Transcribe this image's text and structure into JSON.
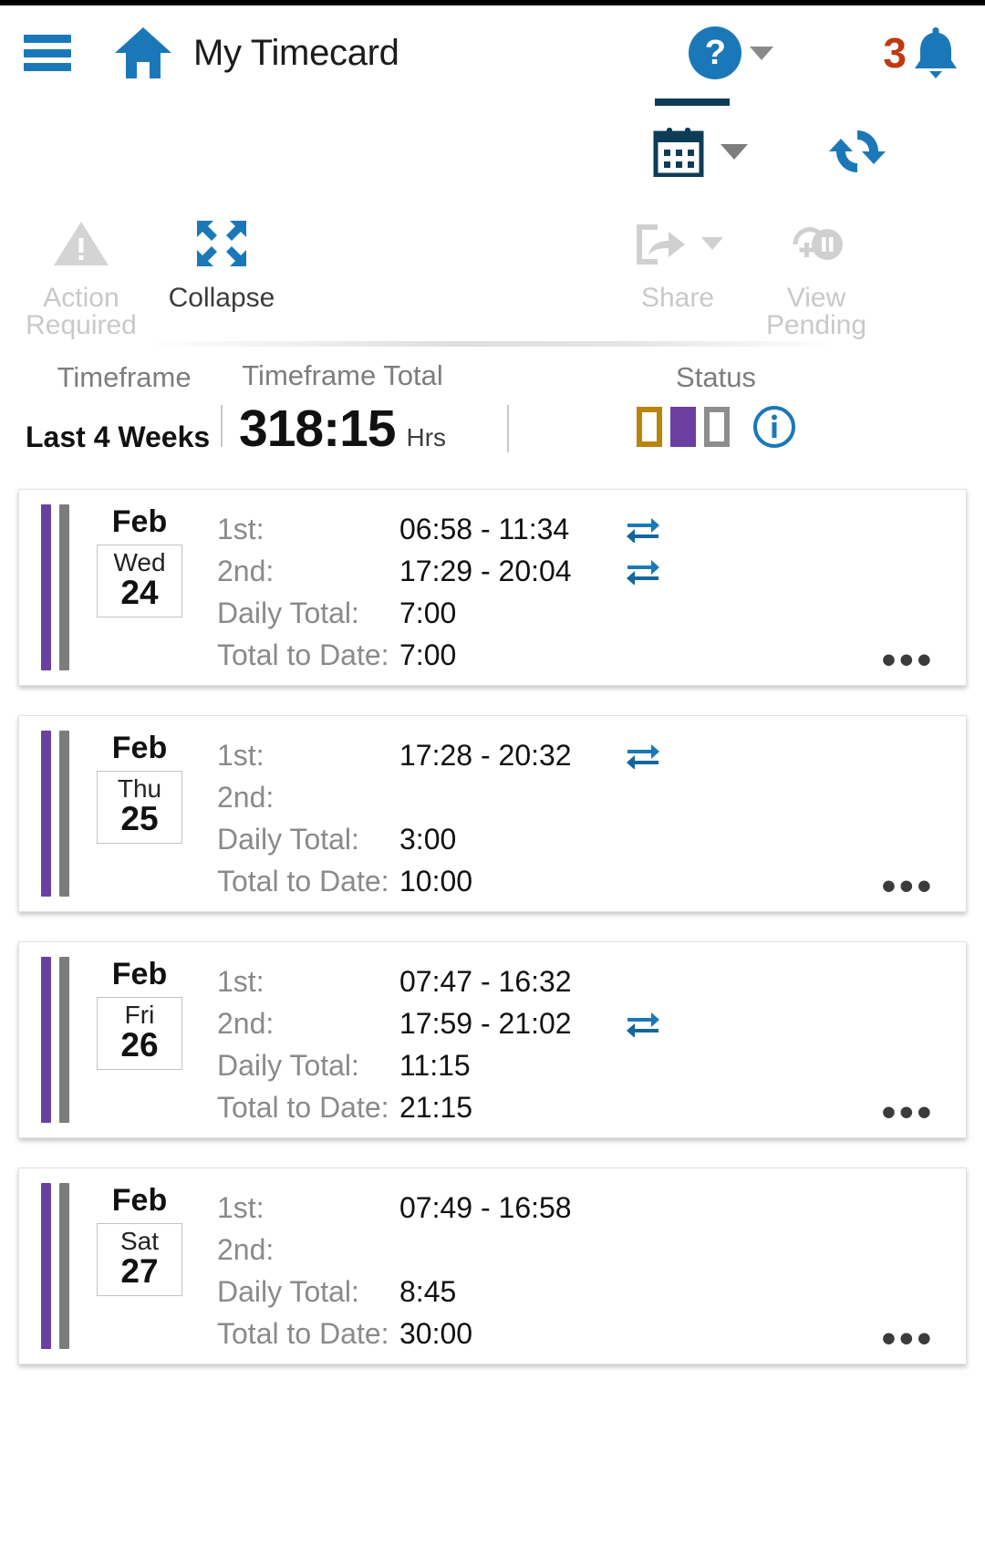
{
  "header": {
    "menu_icon": "hamburger-menu-icon",
    "home_icon": "home-icon",
    "title": "My Timecard",
    "help_icon": "help-question-icon",
    "help_label": "?",
    "notification_count": "3",
    "bell_icon": "notification-bell-icon"
  },
  "subtoolbar": {
    "calendar_icon": "calendar-icon",
    "refresh_icon": "refresh-icon"
  },
  "actions": [
    {
      "label_line1": "Action",
      "label_line2": "Required",
      "icon": "warning-triangle-icon",
      "enabled": false
    },
    {
      "label_line1": "Collapse",
      "label_line2": "",
      "icon": "collapse-arrows-icon",
      "enabled": true
    },
    {
      "label_line1": "Share",
      "label_line2": "",
      "icon": "share-export-icon",
      "enabled": false
    },
    {
      "label_line1": "View",
      "label_line2": "Pending",
      "icon": "view-pending-icon",
      "enabled": false
    }
  ],
  "summary": {
    "timeframe_label": "Timeframe",
    "timeframe_value": "Last 4 Weeks",
    "total_label": "Timeframe Total",
    "total_value": "318:15",
    "total_unit": "Hrs",
    "status_label": "Status",
    "status_chips": [
      {
        "name": "status-chip-gold",
        "color": "#b8860b",
        "filled": false
      },
      {
        "name": "status-chip-purple",
        "color": "#6b3fa0",
        "filled": true
      },
      {
        "name": "status-chip-grey",
        "color": "#8d8d8d",
        "filled": false
      }
    ],
    "info_icon": "info-circle-icon"
  },
  "labels": {
    "first": "1st:",
    "second": "2nd:",
    "daily_total": "Daily Total:",
    "total_to_date": "Total to Date:",
    "overflow": "•••"
  },
  "colors": {
    "accent_blue": "#1b78b8",
    "navy": "#0d3c56",
    "badge_orange": "#c0380f",
    "purple": "#6b3fa0",
    "grey_bar": "#7c7c7c",
    "gold": "#b8860b"
  },
  "days": [
    {
      "month": "Feb",
      "dow": "Wed",
      "daynum": "24",
      "first": "06:58 - 11:34",
      "first_transfer": true,
      "second": "17:29 - 20:04",
      "second_transfer": true,
      "daily_total": "7:00",
      "total_to_date": "7:00"
    },
    {
      "month": "Feb",
      "dow": "Thu",
      "daynum": "25",
      "first": "17:28 - 20:32",
      "first_transfer": true,
      "second": "",
      "second_transfer": false,
      "daily_total": "3:00",
      "total_to_date": "10:00"
    },
    {
      "month": "Feb",
      "dow": "Fri",
      "daynum": "26",
      "first": "07:47 - 16:32",
      "first_transfer": false,
      "second": "17:59 - 21:02",
      "second_transfer": true,
      "daily_total": "11:15",
      "total_to_date": "21:15"
    },
    {
      "month": "Feb",
      "dow": "Sat",
      "daynum": "27",
      "first": "07:49 - 16:58",
      "first_transfer": false,
      "second": "",
      "second_transfer": false,
      "daily_total": "8:45",
      "total_to_date": "30:00"
    }
  ]
}
